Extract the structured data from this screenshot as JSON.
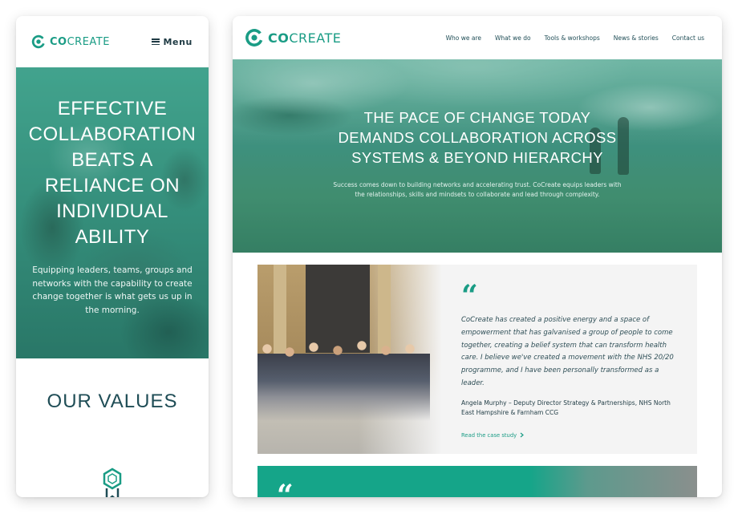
{
  "brand": {
    "name_prefix": "CO",
    "name_suffix": "CREATE",
    "accent": "#1a9c85"
  },
  "mobile": {
    "menu_label": "Menu",
    "hero": {
      "title": "Effective collaboration beats a reliance on individual ability",
      "text": "Equipping leaders, teams, groups and networks with the capability to create change together is what gets us up in the morning."
    },
    "values_heading": "Our values",
    "values_icon": "badge-ribbon-icon"
  },
  "desktop": {
    "nav": [
      "Who we are",
      "What we do",
      "Tools & workshops",
      "News & stories",
      "Contact us"
    ],
    "hero": {
      "title_lines": [
        "The pace of change today",
        "demands collaboration across",
        "systems & beyond hierarchy"
      ],
      "text": "Success comes down to building networks and accelerating trust. CoCreate equips leaders with the relationships, skills and mindsets to collaborate and lead through complexity."
    },
    "testimonial": {
      "quote_glyph": "“",
      "quote": "CoCreate has created a positive energy and a space of empowerment that has galvanised a group of people to come together, creating a belief system that can transform health care. I believe we've created a movement with the NHS 20/20 programme, and I have been personally transformed as a leader.",
      "attribution": "Angela Murphy – Deputy Director Strategy & Partnerships, NHS North East Hampshire & Farnham CCG",
      "link_label": "Read the case study",
      "link_icon": "chevron-right-icon"
    },
    "second_card": {
      "quote_glyph": "“"
    }
  }
}
